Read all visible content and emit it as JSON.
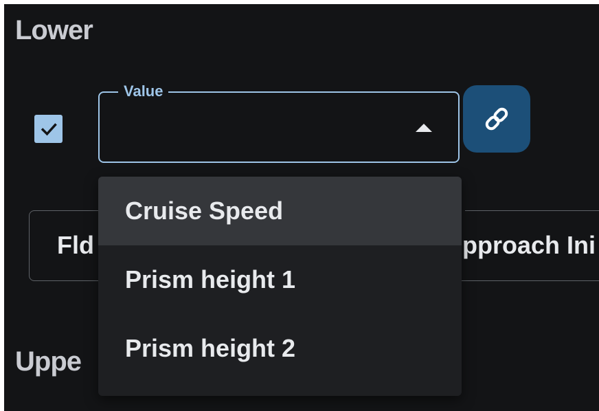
{
  "sections": {
    "lower_heading": "Lower",
    "upper_heading": "Uppe"
  },
  "value_field": {
    "label": "Value",
    "checkbox_checked": true,
    "dropdown_expanded": true
  },
  "link_button": {
    "icon": "link-icon"
  },
  "behind_field": {
    "left_text": "Fld",
    "right_text": "pproach Ini"
  },
  "dropdown": {
    "options": [
      {
        "label": "Cruise Speed",
        "highlighted": true
      },
      {
        "label": "Prism height 1",
        "highlighted": false
      },
      {
        "label": "Prism height 2",
        "highlighted": false
      }
    ]
  },
  "colors": {
    "background": "#131416",
    "accent": "#9ec5e8",
    "button": "#1c4f78",
    "menu": "#1e1f22",
    "menu_highlight": "#35373b",
    "text": "#e8eaed"
  }
}
